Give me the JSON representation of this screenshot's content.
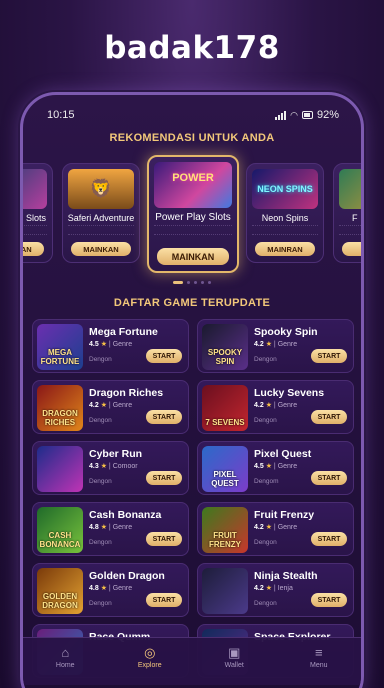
{
  "app": {
    "brand": "badak178"
  },
  "status": {
    "time": "10:15",
    "battery": "92%"
  },
  "recommend": {
    "title": "REKOMENDASI UNTUK ANDA",
    "items": [
      {
        "name": "Slots",
        "thumb_text": "N",
        "button": "MAINKAN"
      },
      {
        "name": "Saferi Adventure",
        "thumb_text": "",
        "button": "MAINKAN"
      },
      {
        "name": "Power Play Slots",
        "thumb_text": "POWER",
        "button": "MAINKAN"
      },
      {
        "name": "Neon Spins",
        "thumb_text": "NEON SPINS",
        "button": "MAINRAN"
      },
      {
        "name": "F",
        "thumb_text": "",
        "button": ""
      }
    ]
  },
  "games": {
    "title": "DAFTAR GAME TERUPDATE",
    "items": [
      {
        "name": "Mega Fortune",
        "rating": "4.5",
        "genre": "Genre",
        "dev": "Dengon",
        "thumb": "MEGA FORTUNE",
        "button": "START"
      },
      {
        "name": "Spooky Spin",
        "rating": "4.2",
        "genre": "Genre",
        "dev": "Dengon",
        "thumb": "SPOOKY SPIN",
        "button": "START"
      },
      {
        "name": "Dragon Riches",
        "rating": "4.2",
        "genre": "Genre",
        "dev": "Dengon",
        "thumb": "DRAGON RICHES",
        "button": "START"
      },
      {
        "name": "Lucky Sevens",
        "rating": "4.2",
        "genre": "Genre",
        "dev": "Dengon",
        "thumb": "7 SEVENS",
        "button": "START"
      },
      {
        "name": "Cyber Run",
        "rating": "4.3",
        "genre": "Comoor",
        "dev": "Dengon",
        "thumb": "",
        "button": "START"
      },
      {
        "name": "Pixel Quest",
        "rating": "4.5",
        "genre": "Genre",
        "dev": "Dengom",
        "thumb": "PIXEL QUEST",
        "button": "START"
      },
      {
        "name": "Cash Bonanza",
        "rating": "4.8",
        "genre": "Genre",
        "dev": "Dengon",
        "thumb": "CASH BONANCA",
        "button": "START"
      },
      {
        "name": "Fruit Frenzy",
        "rating": "4.2",
        "genre": "Genre",
        "dev": "Dengon",
        "thumb": "FRUIT FRENZY",
        "button": "START"
      },
      {
        "name": "Golden Dragon",
        "rating": "4.8",
        "genre": "Genre",
        "dev": "Dengon",
        "thumb": "GOLDEN DRAGON",
        "button": "START"
      },
      {
        "name": "Ninja Stealth",
        "rating": "4.2",
        "genre": "Ienja",
        "dev": "Dengon",
        "thumb": "",
        "button": "START"
      },
      {
        "name": "Race Qumm",
        "rating": "",
        "genre": "",
        "dev": "",
        "thumb": "",
        "button": ""
      },
      {
        "name": "Space Explorer",
        "rating": "",
        "genre": "",
        "dev": "",
        "thumb": "",
        "button": ""
      }
    ]
  },
  "tabs": [
    {
      "label": "Home",
      "icon": "home-icon",
      "glyph": "⌂"
    },
    {
      "label": "Explore",
      "icon": "compass-icon",
      "glyph": "◎"
    },
    {
      "label": "Wallet",
      "icon": "wallet-icon",
      "glyph": "▣"
    },
    {
      "label": "Menu",
      "icon": "menu-icon",
      "glyph": "≡"
    }
  ],
  "colors": {
    "accent": "#e9c07b",
    "background": "#1a0b2e",
    "card": "#33195a"
  }
}
